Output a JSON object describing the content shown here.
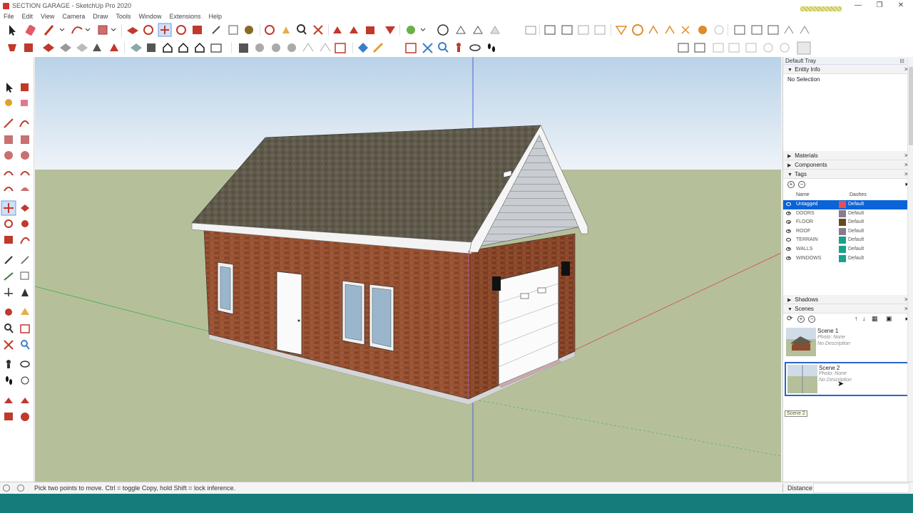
{
  "window": {
    "title": "SECTION GARAGE - SketchUp Pro 2020",
    "minimize": "—",
    "restore": "❐",
    "close": "✕"
  },
  "menu": [
    "File",
    "Edit",
    "View",
    "Camera",
    "Draw",
    "Tools",
    "Window",
    "Extensions",
    "Help"
  ],
  "colors": {
    "sky_top": "#bcd5ea",
    "sky_bottom": "#eaf1f7",
    "ground": "#b5c09a",
    "selection_blue": "#0a63d8",
    "taskbar": "#167b7b"
  },
  "tray": {
    "title": "Default Tray",
    "entity_info": {
      "title": "Entity Info",
      "text": "No Selection"
    },
    "materials": "Materials",
    "components": "Components",
    "tags": {
      "title": "Tags",
      "col_name": "Name",
      "col_dashes": "Dashes",
      "rows": [
        {
          "name": "Untagged",
          "color": "#e0525a",
          "dashes": "Default",
          "visible": true,
          "selected": true
        },
        {
          "name": "DOORS",
          "color": "#8a7a8e",
          "dashes": "Default",
          "visible": true,
          "selected": false
        },
        {
          "name": "FLOOR",
          "color": "#6a4a1c",
          "dashes": "Default",
          "visible": true,
          "selected": false
        },
        {
          "name": "ROOF",
          "color": "#8a7a8e",
          "dashes": "Default",
          "visible": true,
          "selected": false
        },
        {
          "name": "TERRAIN",
          "color": "#17a389",
          "dashes": "Default",
          "visible": false,
          "selected": false
        },
        {
          "name": "WALLS",
          "color": "#17a389",
          "dashes": "Default",
          "visible": true,
          "selected": false
        },
        {
          "name": "WINDOWS",
          "color": "#17a389",
          "dashes": "Default",
          "visible": true,
          "selected": false
        }
      ]
    },
    "shadows": "Shadows",
    "scenes": {
      "title": "Scenes",
      "items": [
        {
          "name": "Scene 1",
          "photo": "Photo: None",
          "description": "No Description",
          "selected": false
        },
        {
          "name": "Scene 2",
          "photo": "Photo: None",
          "description": "No Description",
          "selected": true
        }
      ],
      "tooltip": "Scene 2"
    }
  },
  "status": {
    "hint": "Pick two points to move.  Ctrl = toggle Copy, hold Shift = lock inference.",
    "measurement_label": "Distance"
  },
  "icons": {
    "left_palette": [
      "select-icon",
      "paint-bucket-icon",
      "orbit-icon",
      "eraser-icon",
      "line-icon",
      "freehand-icon",
      "rectangle-icon",
      "rotated-rectangle-icon",
      "circle-icon",
      "polygon-icon",
      "arc-icon",
      "pie-icon",
      "two-point-arc-icon",
      "three-point-arc-icon",
      "move-icon",
      "push-pull-icon",
      "rotate-icon",
      "follow-me-icon",
      "scale-icon",
      "offset-icon",
      "tape-measure-icon",
      "dimension-icon",
      "protractor-icon",
      "text-icon",
      "axes-icon",
      "3d-text-icon",
      "orbit-icon-2",
      "pan-icon",
      "zoom-icon",
      "zoom-window-icon",
      "zoom-extents-icon",
      "search-icon",
      "position-camera-icon",
      "look-around-icon",
      "walk-icon",
      "section-plane-icon",
      "warehouse-icon",
      "extension-icon",
      "ruby-icon",
      "layout-icon"
    ]
  }
}
